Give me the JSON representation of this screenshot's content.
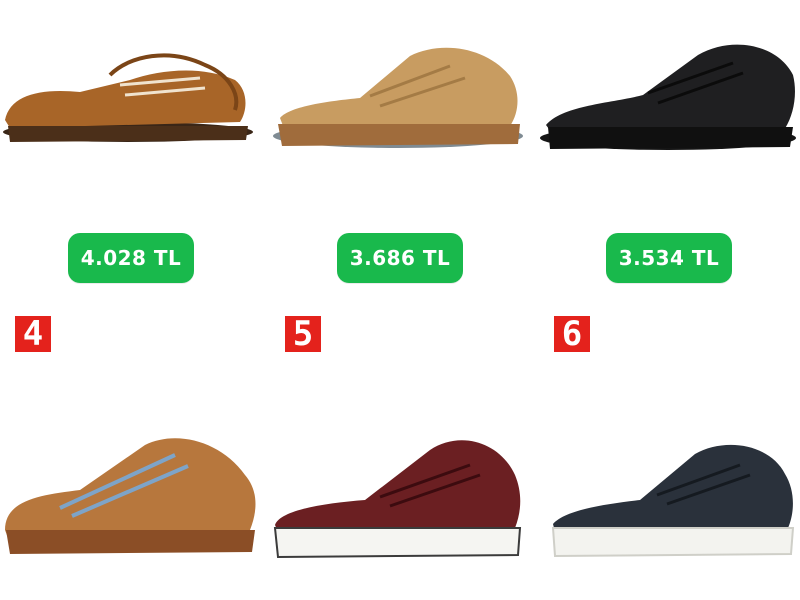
{
  "products_top": [
    {
      "name": "boat-shoe-brown",
      "price": "4.028 TL"
    },
    {
      "name": "mesh-sneaker-beige",
      "price": "3.686 TL"
    },
    {
      "name": "leather-sneaker-black",
      "price": "3.534 TL"
    }
  ],
  "products_bottom": [
    {
      "rank": "4",
      "name": "suede-sneaker-tan"
    },
    {
      "rank": "5",
      "name": "leather-sneaker-burgundy"
    },
    {
      "rank": "6",
      "name": "leather-sneaker-navy"
    }
  ],
  "colors": {
    "price_button": "#19b94c",
    "rank_badge": "#e4221c"
  }
}
